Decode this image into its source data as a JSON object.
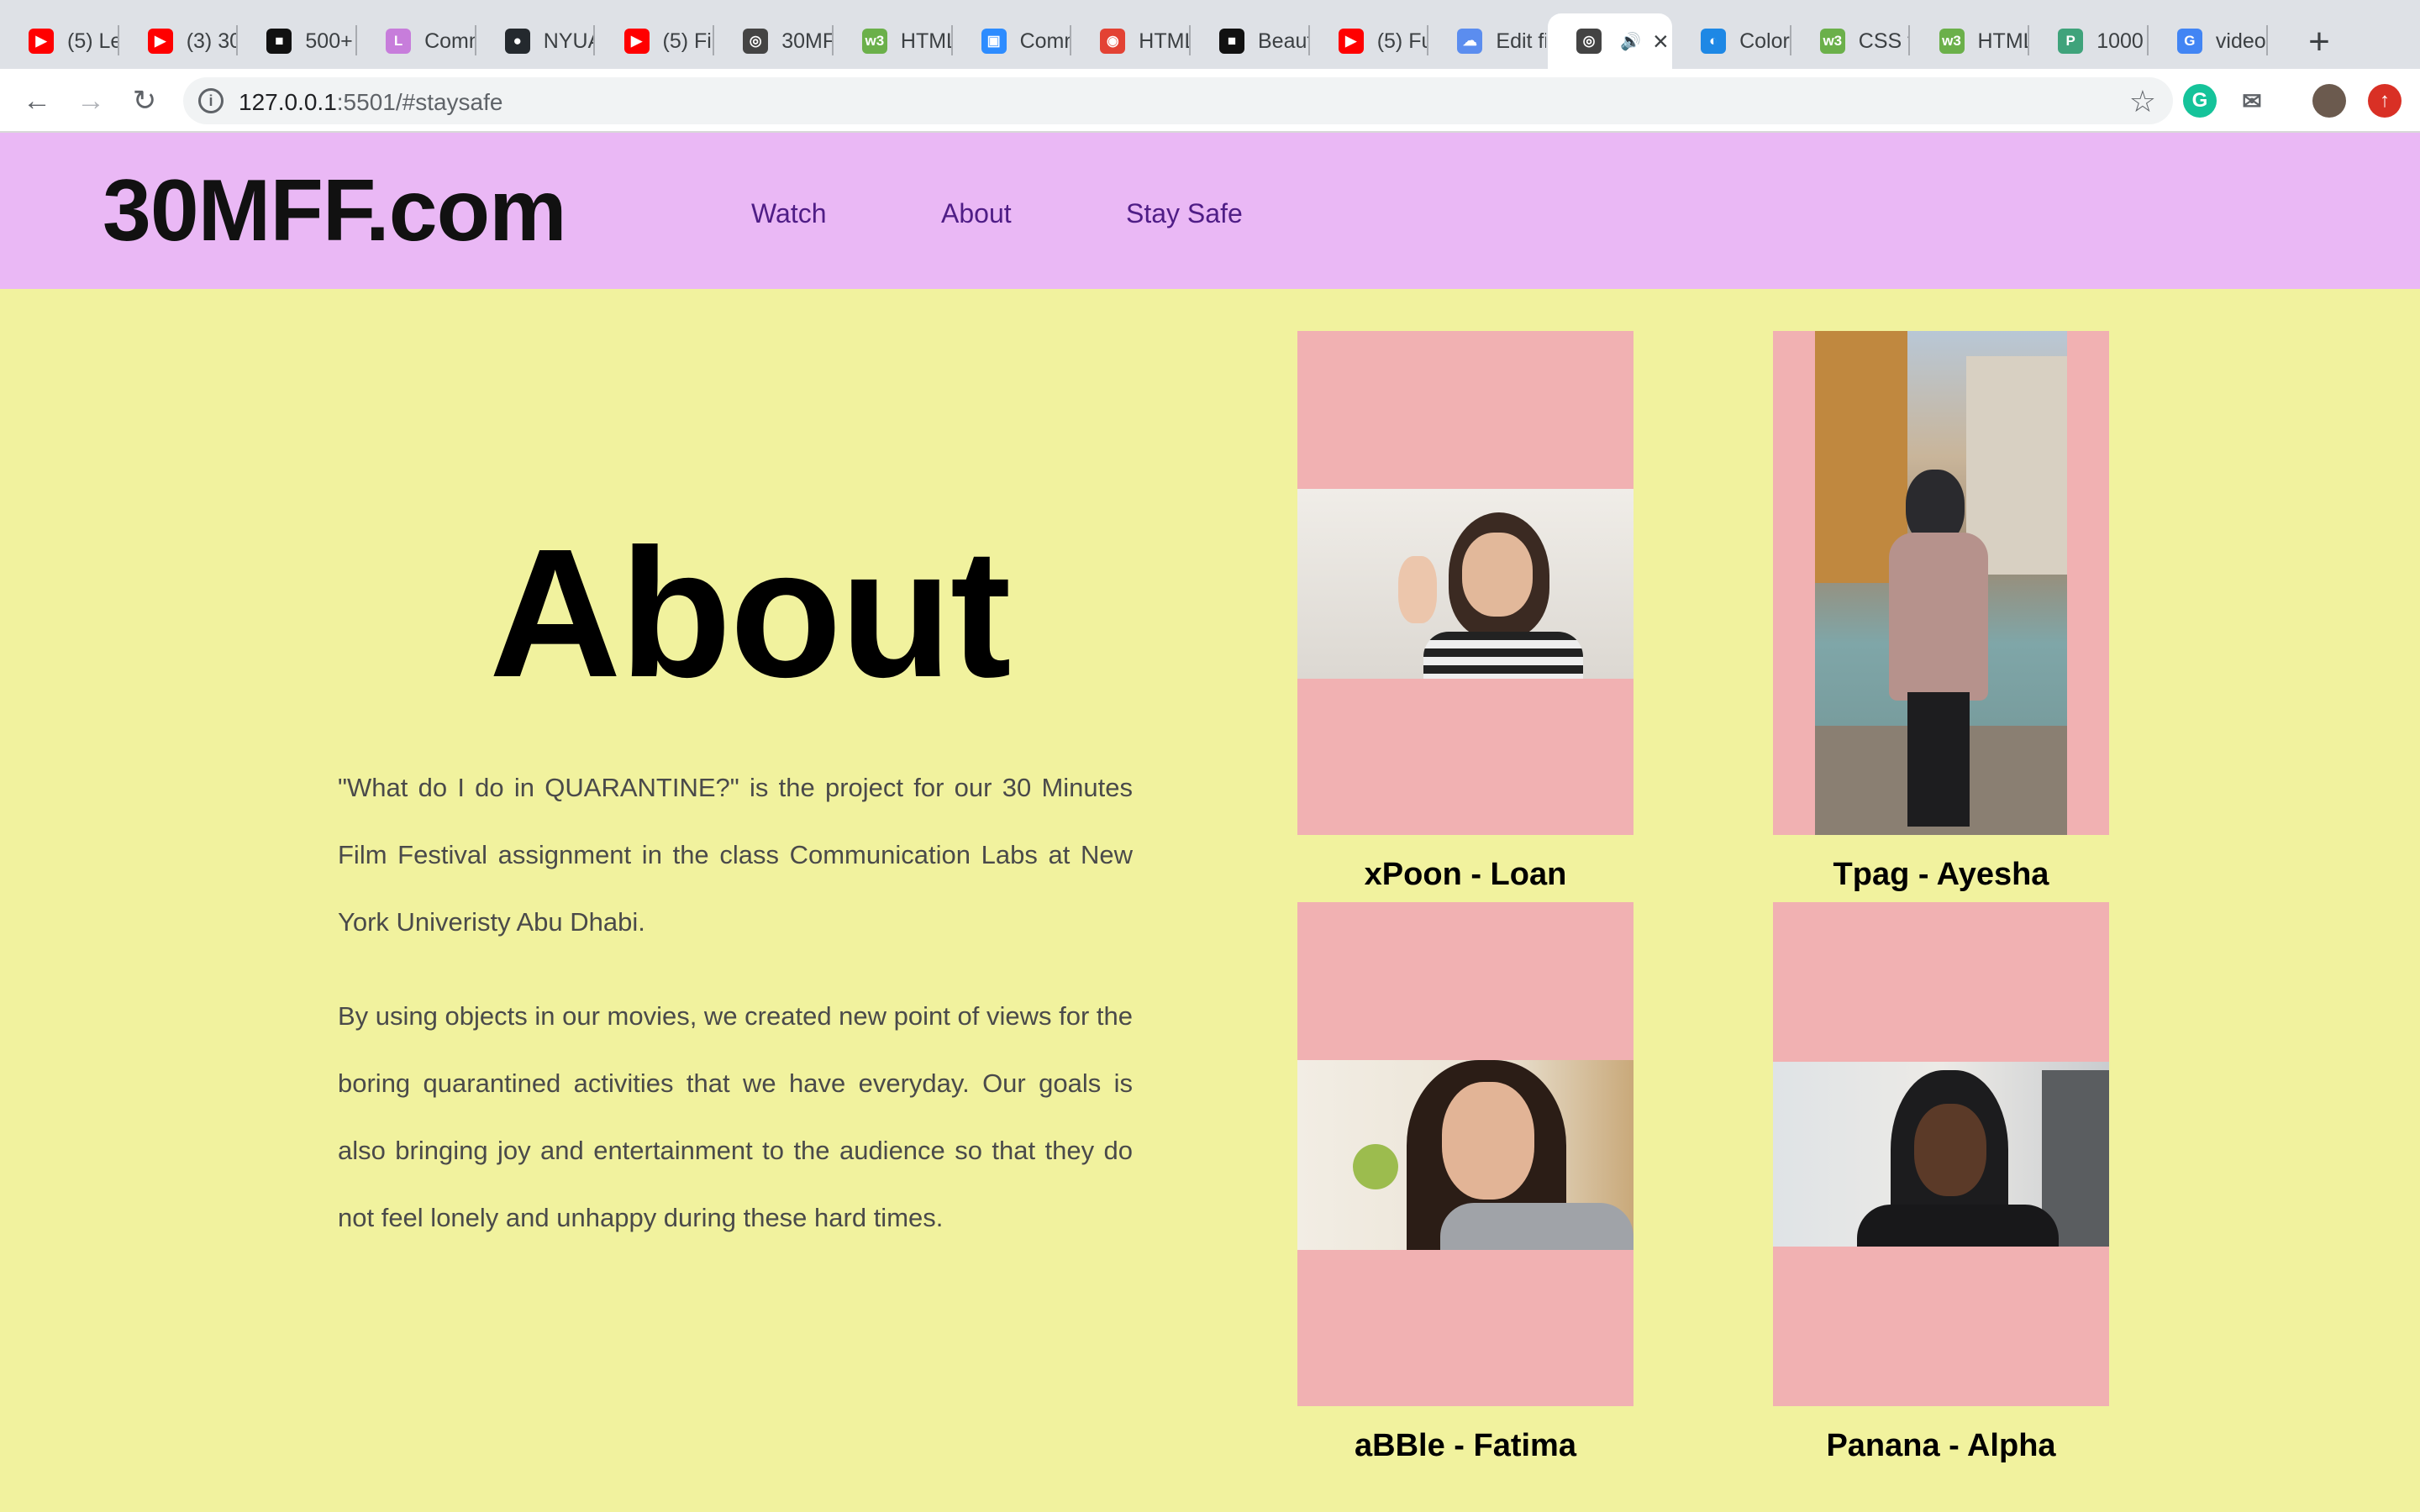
{
  "browser": {
    "tabs": [
      {
        "title": "(5) Le",
        "icon": "youtube-icon"
      },
      {
        "title": "(3) 30",
        "icon": "youtube-icon"
      },
      {
        "title": "500+",
        "icon": "unsplash-icon"
      },
      {
        "title": "Comm",
        "icon": "cl-icon"
      },
      {
        "title": "NYUA",
        "icon": "github-icon"
      },
      {
        "title": "(5) Fi",
        "icon": "youtube-icon"
      },
      {
        "title": "30MF",
        "icon": "globe-icon"
      },
      {
        "title": "HTML",
        "icon": "w3-icon"
      },
      {
        "title": "Comm",
        "icon": "zoom-icon"
      },
      {
        "title": "HTML",
        "icon": "record-icon"
      },
      {
        "title": "Beaut",
        "icon": "unsplash-icon"
      },
      {
        "title": "(5) Fu",
        "icon": "youtube-icon"
      },
      {
        "title": "Edit fi",
        "icon": "cloud-icon"
      },
      {
        "title": "",
        "icon": "globe-icon"
      },
      {
        "title": "Color",
        "icon": "color-icon"
      },
      {
        "title": "CSS t",
        "icon": "w3-icon"
      },
      {
        "title": "HTML",
        "icon": "w3-icon"
      },
      {
        "title": "1000",
        "icon": "p-icon"
      },
      {
        "title": "video",
        "icon": "google-icon"
      }
    ],
    "url_host": "127.0.0.1",
    "url_rest": ":5501/#staysafe"
  },
  "site": {
    "logo": "30MFF.com",
    "nav": [
      "Watch",
      "About",
      "Stay Safe"
    ]
  },
  "about": {
    "title": "About",
    "paragraph1": "\"What do I do in QUARANTINE?\" is the project for our 30 Minutes Film Festival assignment in the class Communication Labs at New York Univeristy Abu Dhabi.",
    "paragraph2": "By using objects in our movies, we created new point of views for the boring quarantined activities that we have everyday. Our goals is also bringing joy and entertainment to the audience so that they do not feel lonely and unhappy during these hard times."
  },
  "films": [
    {
      "caption": "xPoon - Loan"
    },
    {
      "caption": "Tpag - Ayesha"
    },
    {
      "caption": "aBBle - Fatima"
    },
    {
      "caption": "Panana - Alpha"
    }
  ],
  "colors": {
    "page_bg": "#f1f29e",
    "header_bg": "#eab8f5",
    "nav_link": "#4f1d86",
    "card_bg": "#f1b1b2"
  }
}
